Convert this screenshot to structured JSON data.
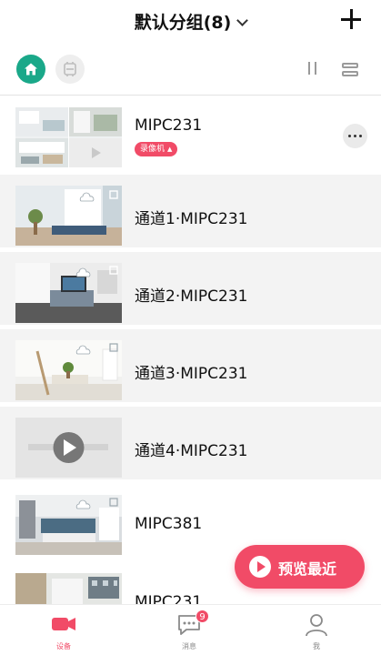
{
  "header": {
    "title": "默认分组(8)"
  },
  "devices": [
    {
      "name": "MIPC231",
      "tag": "录像机",
      "tag_icon": "▲",
      "kind": "nvr"
    },
    {
      "name": "通道1·MIPC231",
      "kind": "channel"
    },
    {
      "name": "通道2·MIPC231",
      "kind": "channel"
    },
    {
      "name": "通道3·MIPC231",
      "kind": "channel"
    },
    {
      "name": "通道4·MIPC231",
      "kind": "channel"
    },
    {
      "name": "MIPC381",
      "kind": "camera"
    },
    {
      "name": "MIPC231",
      "kind": "camera"
    }
  ],
  "fab": {
    "label": "预览最近"
  },
  "tabs": [
    {
      "label": "设备",
      "icon": "camera-icon",
      "active": true
    },
    {
      "label": "消息",
      "icon": "message-icon",
      "badge": "9"
    },
    {
      "label": "我",
      "icon": "person-icon"
    }
  ],
  "colors": {
    "accent": "#f14b67",
    "home": "#1aa889"
  }
}
